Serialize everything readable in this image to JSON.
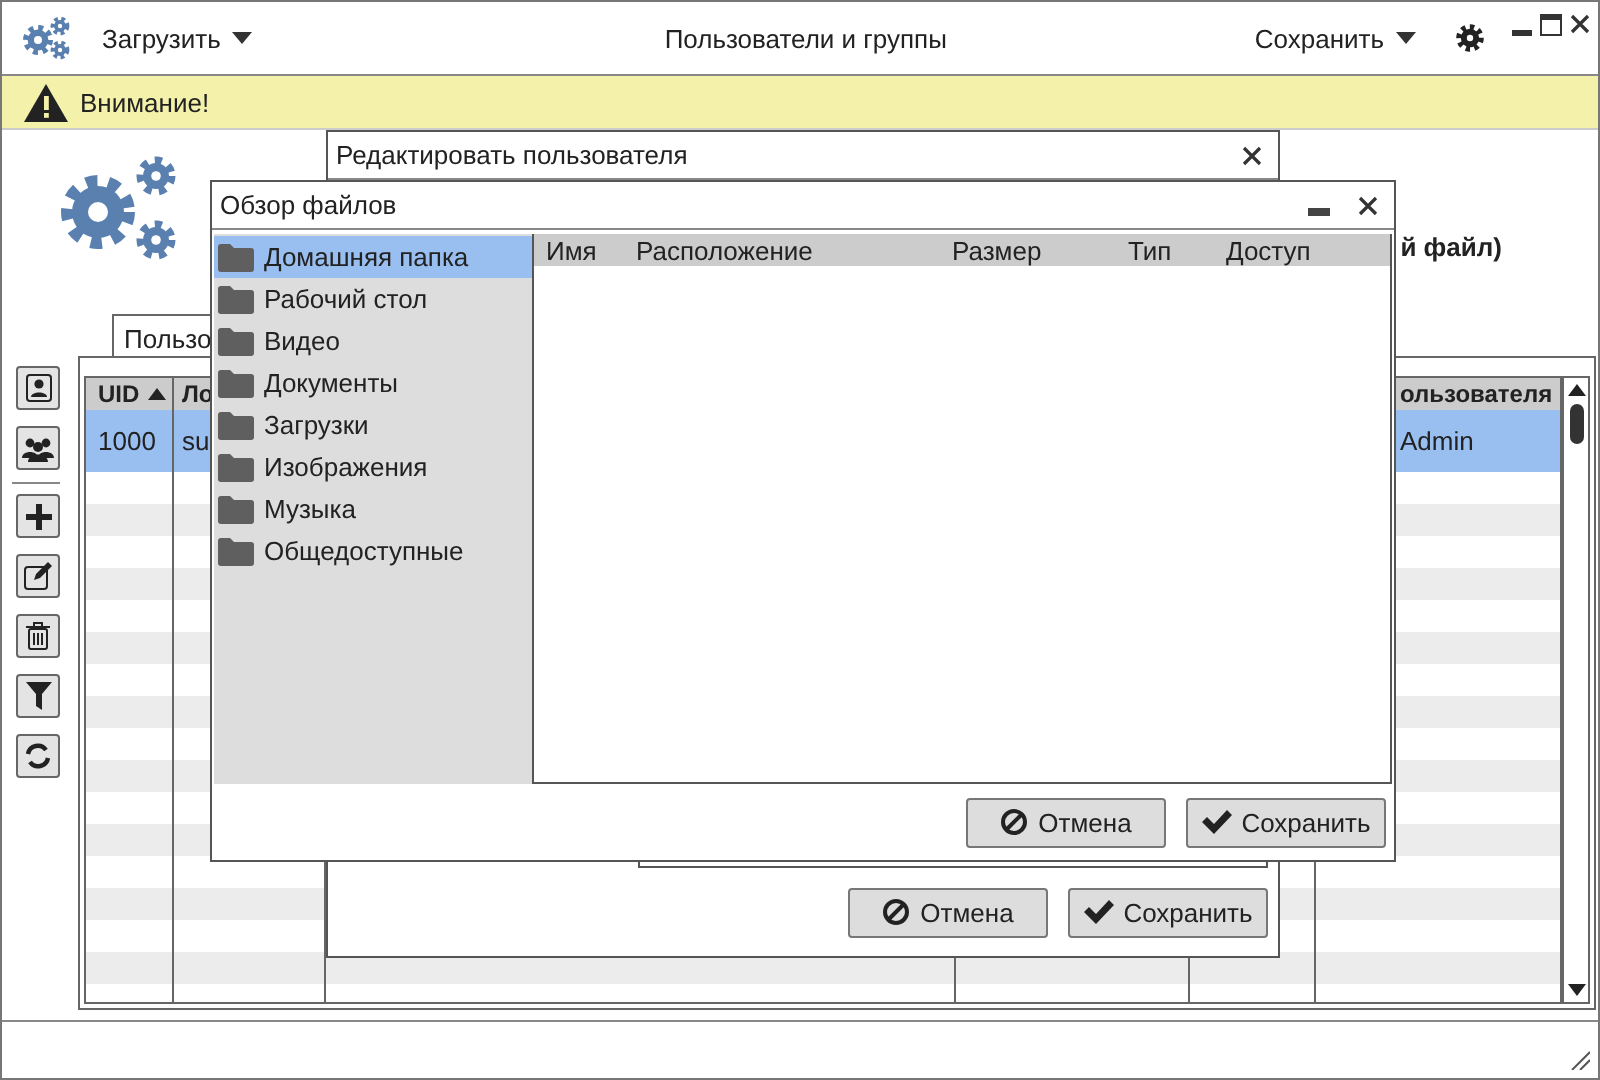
{
  "app": {
    "menu_left": "Загрузить",
    "title": "Пользователи и группы",
    "menu_right": "Сохранить"
  },
  "alert": {
    "text": "Внимание!"
  },
  "header": {
    "subtitle_fragment": "й файл)"
  },
  "tabs": [
    {
      "label": "Пользо",
      "selected": true
    }
  ],
  "table": {
    "columns": [
      {
        "label": "UID",
        "sorted": true
      },
      {
        "label": "Ло"
      },
      {},
      {},
      {},
      {
        "label": "ользователя"
      }
    ],
    "rows": [
      {
        "cells": [
          "1000",
          "su",
          null,
          null,
          null,
          "Admin"
        ],
        "selected": true
      }
    ]
  },
  "edit_dialog": {
    "title": "Редактировать пользователя",
    "buttons": [
      {
        "kind": "cancel",
        "label": "Отмена"
      },
      {
        "kind": "save",
        "label": "Сохранить"
      }
    ]
  },
  "file_dialog": {
    "title": "Обзор файлов",
    "places": [
      {
        "label": "Домашняя папка",
        "selected": true
      },
      {
        "label": "Рабочий стол",
        "selected": false
      },
      {
        "label": "Видео",
        "selected": false
      },
      {
        "label": "Документы",
        "selected": false
      },
      {
        "label": "Загрузки",
        "selected": false
      },
      {
        "label": "Изображения",
        "selected": false
      },
      {
        "label": "Музыка",
        "selected": false
      },
      {
        "label": "Общедоступные",
        "selected": false
      }
    ],
    "columns": [
      "Имя",
      "Расположение",
      "Размер",
      "Тип",
      "Доступ"
    ],
    "buttons": [
      {
        "kind": "cancel",
        "label": "Отмена"
      },
      {
        "kind": "save",
        "label": "Сохранить"
      }
    ]
  }
}
